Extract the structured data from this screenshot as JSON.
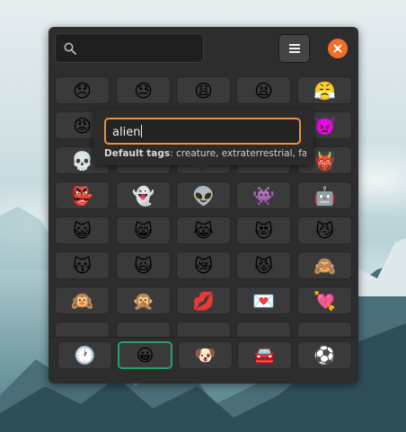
{
  "search": {
    "value": "",
    "placeholder": ""
  },
  "rows": [
    [
      "😞",
      "😓",
      "😩",
      "😫",
      "😤"
    ],
    [
      "😡",
      "",
      "",
      "",
      "👿"
    ],
    [
      "💀",
      "",
      "",
      "",
      "👹"
    ],
    [
      "👺",
      "👻",
      "👽",
      "👾",
      "🤖"
    ],
    [
      "😺",
      "😸",
      "😹",
      "😻",
      "😼"
    ],
    [
      "😽",
      "🙀",
      "😿",
      "😾",
      "🙈"
    ],
    [
      "🙉",
      "🙊",
      "💋",
      "💌",
      "💘"
    ]
  ],
  "popover": {
    "value": "alien",
    "tags_label": "Default tags",
    "tags_text": ": creature, extraterrestrial, fa..."
  },
  "categories": [
    "🕐",
    "😀",
    "🐶",
    "🚘",
    "⚽"
  ],
  "active_category": 1,
  "colors": {
    "accent": "#f46d28",
    "focus": "#e8913f",
    "active": "#26a269"
  }
}
